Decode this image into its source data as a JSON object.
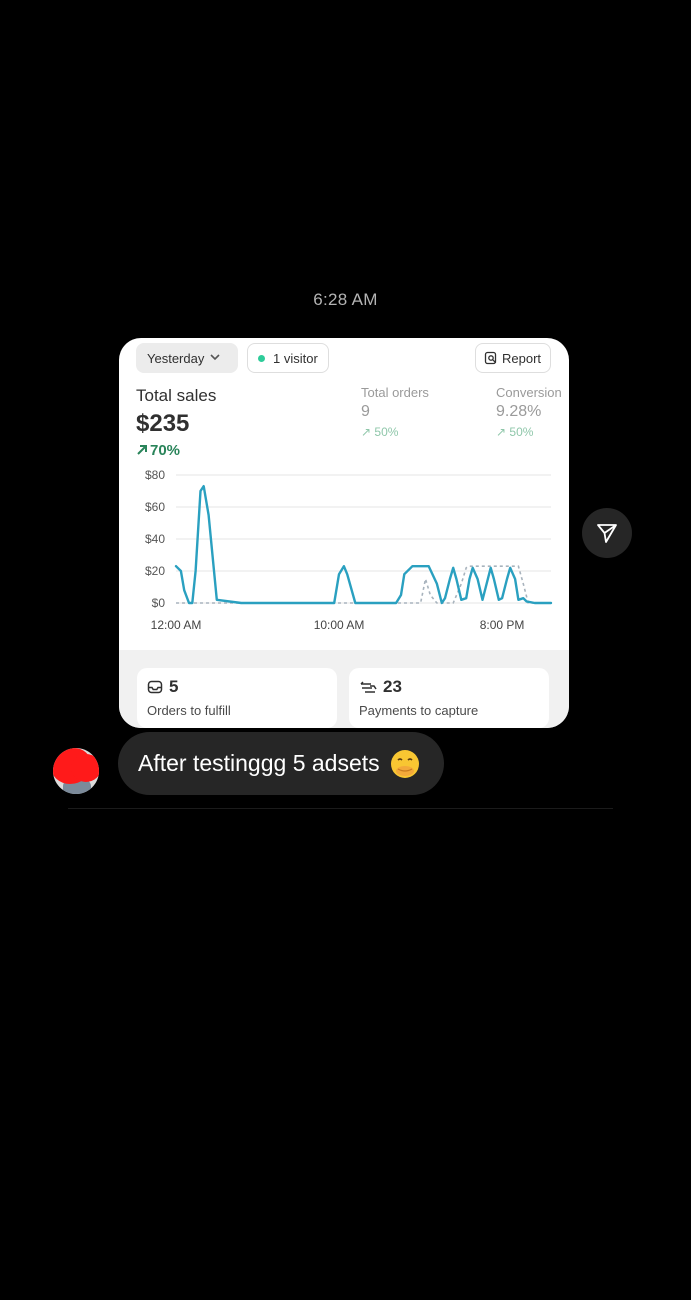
{
  "timestamp": "6:28 AM",
  "card": {
    "date_filter": "Yesterday",
    "visitors": "1 visitor",
    "report_button": "Report",
    "total_sales_label": "Total sales",
    "total_sales_value": "$235",
    "total_sales_change": "70%",
    "metrics": [
      {
        "label": "Total orders",
        "value": "9",
        "change": "50%"
      },
      {
        "label": "Conversion",
        "value": "9.28%",
        "change": "50%"
      }
    ],
    "stats": [
      {
        "value": "5",
        "label": "Orders to fulfill",
        "icon": "inbox-icon"
      },
      {
        "value": "23",
        "label": "Payments to capture",
        "icon": "cash-icon"
      }
    ],
    "colors": {
      "line": "#2aa0c0",
      "positive": "#29845a",
      "comparison": "#a8b3bd"
    }
  },
  "chart_data": {
    "type": "line",
    "y_ticks": [
      "$80",
      "$60",
      "$40",
      "$20",
      "$0"
    ],
    "ylim": [
      0,
      80
    ],
    "x_ticks": [
      "12:00 AM",
      "10:00 AM",
      "8:00 PM"
    ],
    "grid": true,
    "series": [
      {
        "x": [
          0,
          0.3,
          0.5,
          0.8,
          1,
          1.2,
          1.5,
          1.7,
          2,
          2.5,
          4,
          8,
          9.7,
          10,
          10.3,
          10.5,
          11,
          12,
          13,
          13.5,
          13.8,
          14,
          14.5,
          15,
          15.5,
          16,
          16.3,
          16.5,
          16.8,
          17,
          17.2,
          17.5,
          17.8,
          18,
          18.2,
          18.5,
          18.8,
          19,
          19.3,
          19.5,
          19.8,
          20,
          20.3,
          20.5,
          20.8,
          21,
          21.3,
          21.5,
          22,
          23
        ],
        "values": [
          23,
          20,
          8,
          0,
          0,
          20,
          70,
          73,
          55,
          2,
          0,
          0,
          0,
          18,
          23,
          18,
          0,
          0,
          0,
          0,
          5,
          18,
          23,
          23,
          23,
          12,
          0,
          3,
          15,
          22,
          15,
          2,
          3,
          15,
          22,
          15,
          2,
          10,
          22,
          15,
          2,
          3,
          15,
          22,
          15,
          2,
          3,
          1,
          0,
          0
        ]
      },
      {
        "x": [
          0,
          1,
          4,
          8,
          13,
          15,
          15.3,
          15.6,
          16,
          17,
          17.5,
          17.8,
          18,
          20,
          21,
          21.3,
          21.6,
          22,
          23
        ],
        "values": [
          0,
          0,
          0,
          0,
          0,
          0,
          15,
          5,
          0,
          0,
          12,
          22,
          23,
          23,
          23,
          12,
          0,
          0,
          0
        ]
      }
    ]
  },
  "message": {
    "text": "After testinggg 5 adsets",
    "emoji": "face-with-hand-over-mouth-emoji"
  }
}
